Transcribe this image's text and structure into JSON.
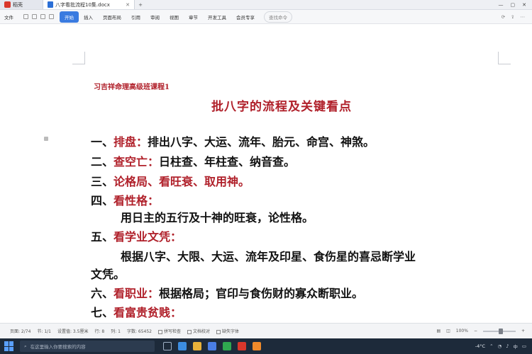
{
  "window": {
    "app_tab": "稻壳",
    "doc_tab": "八字看批流程10集.docx",
    "new_tab": "+"
  },
  "menubar": {
    "file": "文件",
    "items": [
      "开始",
      "插入",
      "页面布局",
      "引用",
      "审阅",
      "视图",
      "章节",
      "开发工具",
      "会员专享"
    ],
    "active_index": 0,
    "search": "查找命令"
  },
  "document": {
    "header_note": "习吉祥命理高级班课程1",
    "title": "批八字的流程及关键看点",
    "lines": [
      {
        "num": "一、",
        "key": "排盘：",
        "text": "排出八字、大运、流年、胎元、命宫、神煞。"
      },
      {
        "num": "二、",
        "key": "查空亡：",
        "text": "日柱查、年柱查、纳音查。"
      },
      {
        "num": "三、",
        "key": "论格局、看旺衰、取用神。",
        "text": ""
      },
      {
        "num": "四、",
        "key": "看性格：",
        "text": ""
      },
      {
        "num": "",
        "key": "",
        "text": "用日主的五行及十神的旺衰，论性格。"
      },
      {
        "num": "五、",
        "key": "看学业文凭：",
        "text": ""
      },
      {
        "num": "",
        "key": "",
        "text": "根据八字、大限、大运、流年及印星、食伤星的喜忌断学业"
      },
      {
        "num": "",
        "key": "",
        "text": "文凭。"
      },
      {
        "num": "六、",
        "key": "看职业：",
        "text": "根据格局；官印与食伤财的寡众断职业。"
      },
      {
        "num": "七、",
        "key": "看富贵贫贱：",
        "text": ""
      }
    ]
  },
  "statusbar": {
    "page": "页面: 2/74",
    "section": "节: 1/1",
    "setting": "设置值: 3.5厘米",
    "row": "行: 8",
    "col": "列: 1",
    "words": "字数: 65452",
    "spell": "拼写检查",
    "proofread": "文档校对",
    "missing_font": "缺失字体",
    "zoom": "100%",
    "zoom_level": 0.55
  },
  "taskbar": {
    "search_placeholder": "在这里输入你要搜索的内容",
    "weather": "-4°C",
    "ime": "中",
    "colors": {
      "edge": "#3c8de0",
      "folder": "#e8b13a",
      "wps": "#d9372b",
      "chrome": "#2fa84f",
      "store": "#4a7ee6",
      "other": "#ef8a2b"
    }
  }
}
